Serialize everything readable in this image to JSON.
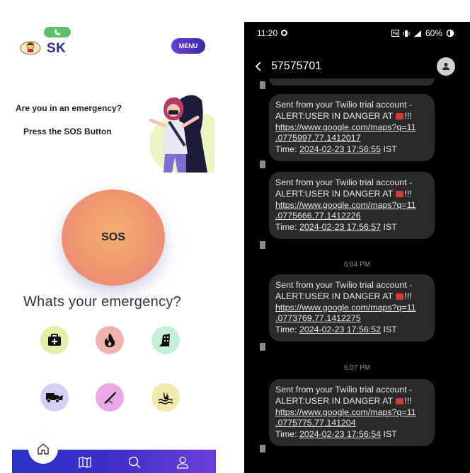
{
  "left_app": {
    "brand": "SK",
    "menu_label": "MENU",
    "question": "Are you in an emergency?",
    "instruction": "Press the SOS Button",
    "sos_label": "SOS",
    "section_heading": "Whats your emergency?",
    "categories": [
      {
        "icon": "medical-kit-icon",
        "color": "#dff0a8"
      },
      {
        "icon": "fire-icon",
        "color": "#f0b3ae"
      },
      {
        "icon": "building-collapse-icon",
        "color": "#c6efd9"
      },
      {
        "icon": "accident-vehicle-icon",
        "color": "#d3d0f3"
      },
      {
        "icon": "knife-icon",
        "color": "#e8a9e6"
      },
      {
        "icon": "drowning-icon",
        "color": "#f2e9ad"
      }
    ],
    "nav_items": [
      "home-icon",
      "map-book-icon",
      "search-icon",
      "profile-icon"
    ]
  },
  "messages_app": {
    "status_time": "11:20",
    "battery": "60%",
    "contact": "57575701",
    "messages": [
      {
        "text": "Sent from your Twilio trial account - ALERT:USER IN DANGER AT",
        "suffix": "!!!",
        "link_line1": "https://www.google.com/maps?q=11",
        "link_line2": ".0775997,77.1412017",
        "time_label": "Time: ",
        "time_value": "2024-02-23 17:56:55",
        "tz": " IST"
      },
      {
        "text": "Sent from your Twilio trial account - ALERT:USER IN DANGER AT",
        "suffix": "!!!",
        "link_line1": "https://www.google.com/maps?q=11",
        "link_line2": ".0775666,77.1412226",
        "time_label": "Time: ",
        "time_value": "2024-02-23 17:56:57",
        "tz": " IST"
      },
      {
        "text": "Sent from your Twilio trial account - ALERT:USER IN DANGER AT",
        "suffix": "!!!",
        "link_line1": "https://www.google.com/maps?q=11",
        "link_line2": ".0773769,77.1412275",
        "time_label": "Time: ",
        "time_value": "2024-02-23 17:56:52",
        "tz": " IST"
      },
      {
        "text": "Sent from your Twilio trial account - ALERT:USER IN DANGER AT",
        "suffix": "!!!",
        "link_line1": "https://www.google.com/maps?q=11",
        "link_line2": ".0775775,77.141204",
        "time_label": "Time: ",
        "time_value": "2024-02-23 17:56:54",
        "tz": " IST"
      }
    ],
    "dividers": [
      "6:04 PM",
      "6:07 PM"
    ]
  }
}
